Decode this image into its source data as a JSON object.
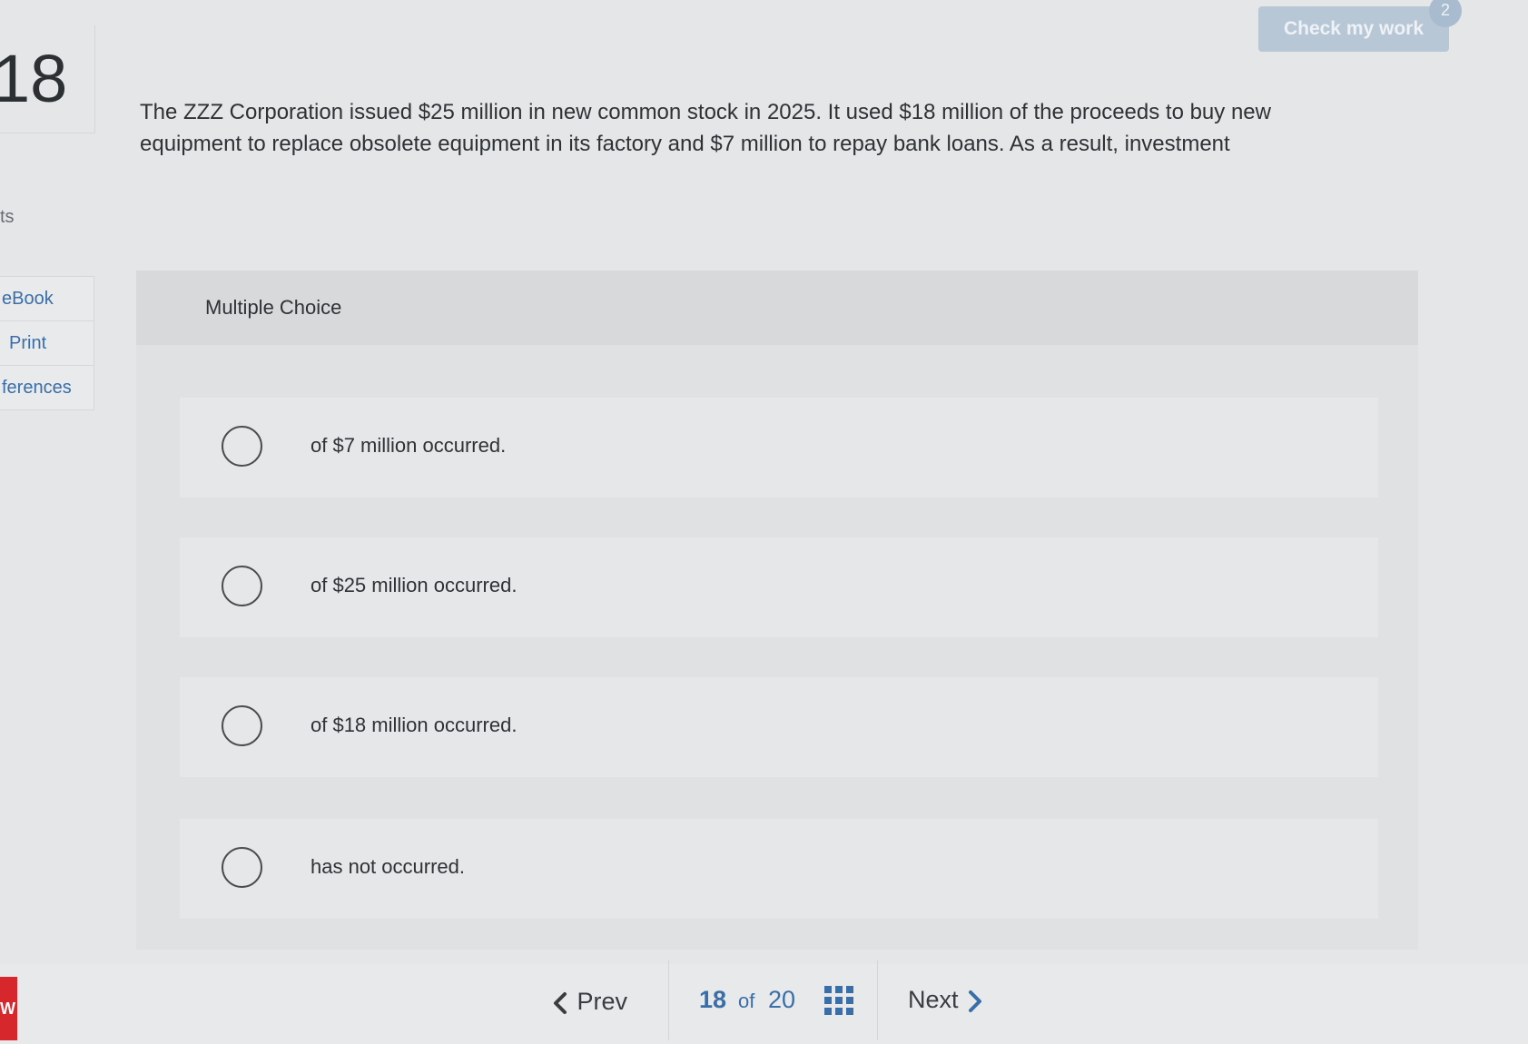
{
  "question_number": "18",
  "sidebar": {
    "points_label": "ts",
    "tools": [
      {
        "label": "eBook"
      },
      {
        "label": "Print"
      },
      {
        "label": "ferences"
      }
    ]
  },
  "header": {
    "check_button_label": "Check my work",
    "check_badge": "2"
  },
  "question_text": "The ZZZ Corporation issued $25 million in new common stock in 2025. It used $18 million of the proceeds to buy new equipment to replace obsolete equipment in its factory and $7 million to repay bank loans. As a result, investment",
  "multiple_choice": {
    "header": "Multiple Choice",
    "options": [
      {
        "label": "of $7 million occurred."
      },
      {
        "label": "of $25 million occurred."
      },
      {
        "label": "of $18 million occurred."
      },
      {
        "label": "has not occurred."
      }
    ]
  },
  "navigation": {
    "prev_label": "Prev",
    "current_page": "18",
    "of_label": "of",
    "total_pages": "20",
    "next_label": "Next"
  },
  "brand_tab": "W",
  "colors": {
    "accent_blue": "#3a6ea8",
    "check_button": "#b8c7d6",
    "brand_red": "#d6272d"
  }
}
